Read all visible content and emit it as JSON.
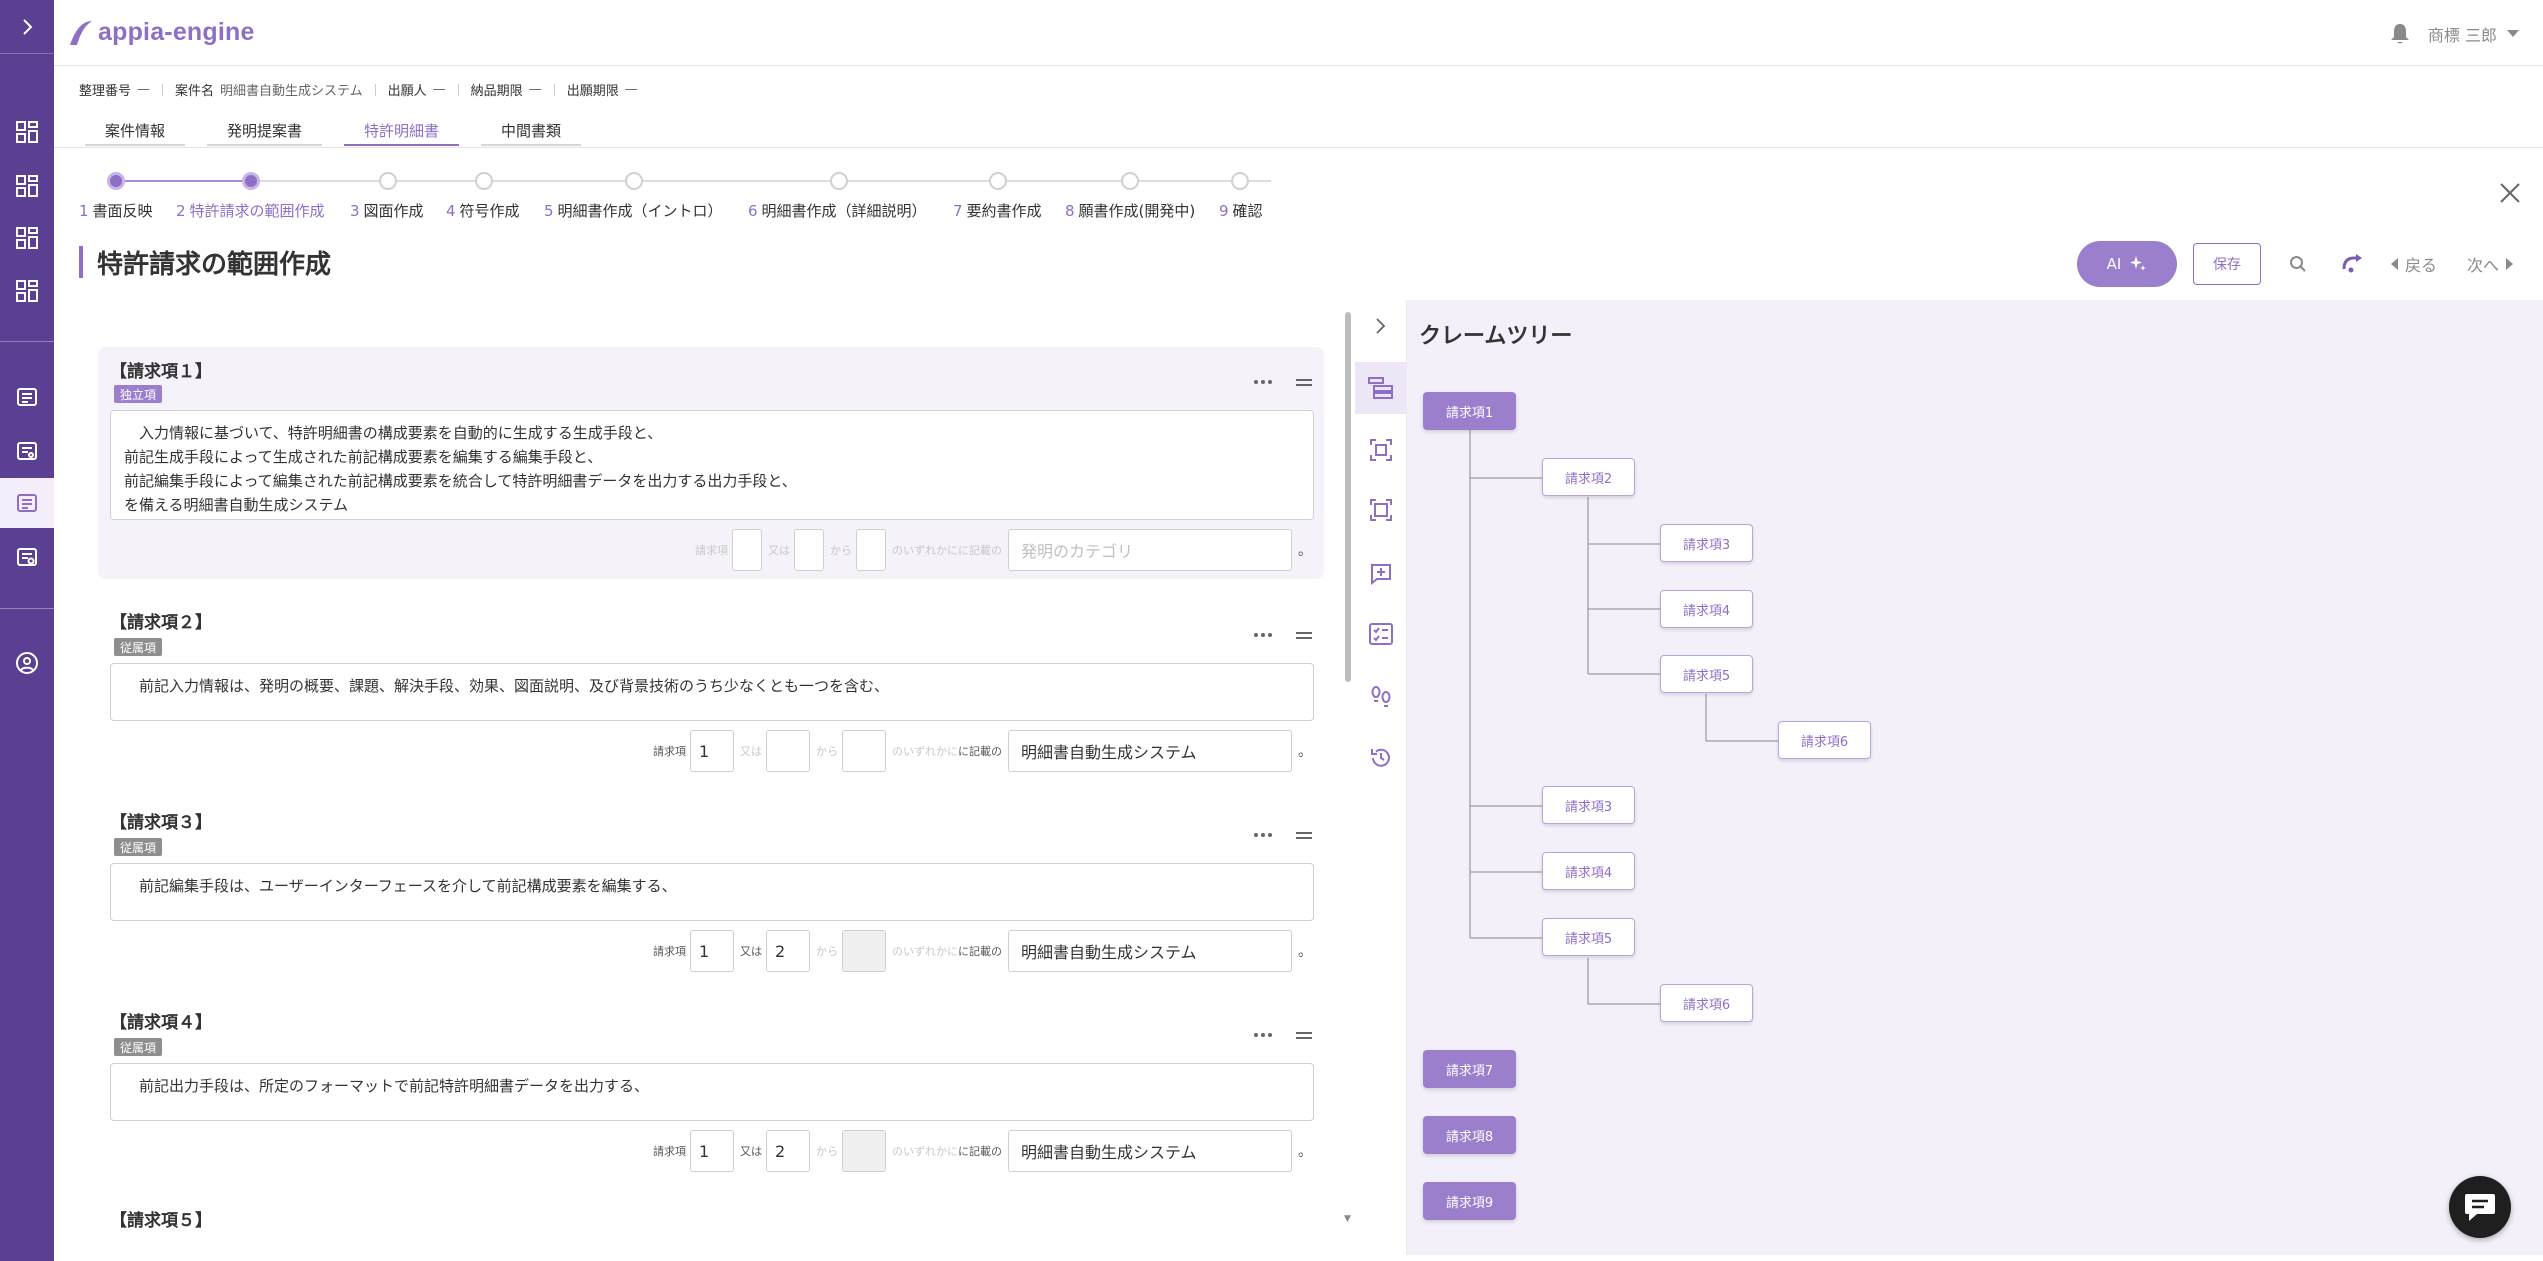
{
  "app": {
    "logo_text": "appia-engine"
  },
  "user": {
    "name": "商標 三郎"
  },
  "meta": [
    {
      "label": "整理番号",
      "value": "—"
    },
    {
      "label": "案件名",
      "value": "明細書自動生成システム"
    },
    {
      "label": "出願人",
      "value": "—"
    },
    {
      "label": "納品期限",
      "value": "—"
    },
    {
      "label": "出願期限",
      "value": "—"
    }
  ],
  "tabs": [
    "案件情報",
    "発明提案書",
    "特許明細書",
    "中間書類"
  ],
  "active_tab": 2,
  "steps": [
    {
      "num": "1",
      "label": "書面反映"
    },
    {
      "num": "2",
      "label": "特許請求の範囲作成"
    },
    {
      "num": "3",
      "label": "図面作成"
    },
    {
      "num": "4",
      "label": "符号作成"
    },
    {
      "num": "5",
      "label": "明細書作成（イントロ）"
    },
    {
      "num": "6",
      "label": "明細書作成（詳細説明）"
    },
    {
      "num": "7",
      "label": "要約書作成"
    },
    {
      "num": "8",
      "label": "願書作成(開発中)"
    },
    {
      "num": "9",
      "label": "確認"
    }
  ],
  "current_step": 2,
  "page_title": "特許請求の範囲作成",
  "actions": {
    "ai": "AI",
    "save": "保存",
    "back": "戻る",
    "next": "次へ"
  },
  "ref_labels": {
    "claim": "請求項",
    "or": "又は",
    "from": "から",
    "any": "のいずれかに",
    "described": "に記載の",
    "end": "。"
  },
  "claims": [
    {
      "title": "【請求項１】",
      "badge": "独立項",
      "text": "　入力情報に基づいて、特許明細書の構成要素を自動的に生成する生成手段と、\n前記生成手段によって生成された前記構成要素を編集する編集手段と、\n前記編集手段によって編集された前記構成要素を統合して特許明細書データを出力する出力手段と、\nを備える明細書自動生成システム",
      "ref1": "",
      "ref2": "",
      "category": "",
      "category_placeholder": "発明のカテゴリ"
    },
    {
      "title": "【請求項２】",
      "badge": "従属項",
      "text": "　前記入力情報は、発明の概要、課題、解決手段、効果、図面説明、及び背景技術のうち少なくとも一つを含む、",
      "ref1": "1",
      "ref2": "",
      "category": "明細書自動生成システム"
    },
    {
      "title": "【請求項３】",
      "badge": "従属項",
      "text": "　前記編集手段は、ユーザーインターフェースを介して前記構成要素を編集する、",
      "ref1": "1",
      "ref2": "2",
      "category": "明細書自動生成システム"
    },
    {
      "title": "【請求項４】",
      "badge": "従属項",
      "text": "　前記出力手段は、所定のフォーマットで前記特許明細書データを出力する、",
      "ref1": "1",
      "ref2": "2",
      "category": "明細書自動生成システム"
    },
    {
      "title": "【請求項５】"
    }
  ],
  "tree": {
    "title": "クレームツリー",
    "nodes": [
      "請求項1",
      "請求項2",
      "請求項3",
      "請求項4",
      "請求項5",
      "請求項6",
      "請求項3",
      "請求項4",
      "請求項5",
      "請求項6",
      "請求項7",
      "請求項8",
      "請求項9"
    ]
  },
  "colors": {
    "brand": "#5b3f93",
    "accent": "#8f6fc6",
    "panel": "#f4f0fa"
  }
}
